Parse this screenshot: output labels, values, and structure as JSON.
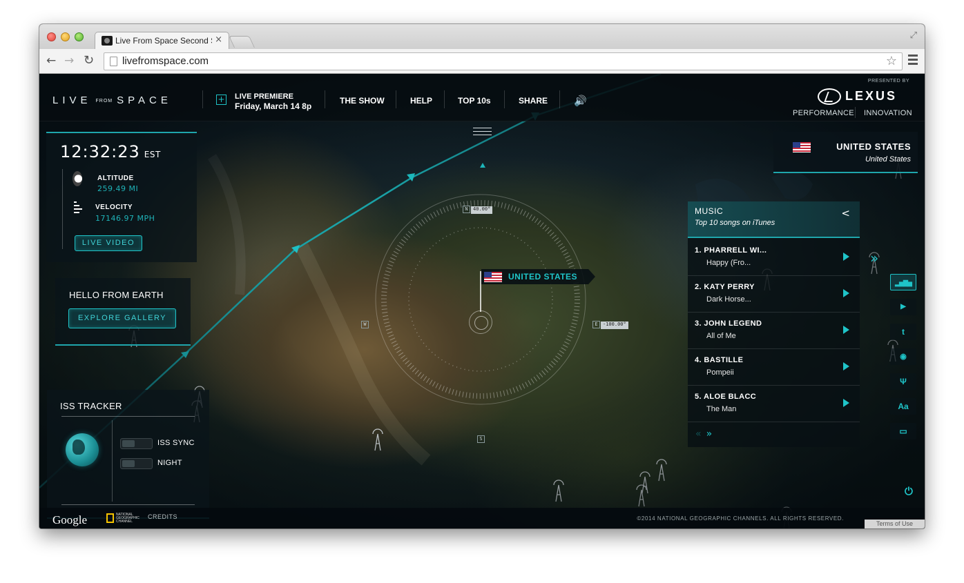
{
  "browser": {
    "tab_title": "Live From Space Second Screen",
    "tab_close": "×",
    "url": "livefromspace.com",
    "back": "←",
    "forward": "→",
    "reload": "↻",
    "star": "☆",
    "fullscreen": "⤢"
  },
  "header": {
    "logo_live": "LIVE",
    "logo_from": "FROM",
    "logo_space": "SPACE",
    "premiere_label": "LIVE PREMIERE",
    "premiere_date": "Friday, March 14 8p",
    "nav": [
      "THE SHOW",
      "HELP",
      "TOP 10s",
      "SHARE"
    ],
    "sound_icon": "🔊",
    "presented_by": "PRESENTED BY",
    "sponsor": "LEXUS",
    "sponsor_links": [
      "PERFORMANCE",
      "INNOVATION"
    ]
  },
  "status": {
    "time": "12:32:23",
    "timezone": "EST",
    "altitude_label": "ALTITUDE",
    "altitude_value": "259.49 MI",
    "velocity_label": "VELOCITY",
    "velocity_value": "17146.97 MPH",
    "live_video_label": "LIVE VIDEO"
  },
  "hello": {
    "title": "HELLO FROM EARTH",
    "button": "EXPLORE GALLERY"
  },
  "tracker": {
    "title": "ISS TRACKER",
    "toggles": [
      {
        "label": "ISS SYNC"
      },
      {
        "label": "NIGHT"
      }
    ]
  },
  "map": {
    "north_letter": "N",
    "north_value": "40.00°",
    "east_letter": "E",
    "east_value": "-100.00°",
    "west_letter": "W",
    "south_letter": "S",
    "location_label": "UNITED STATES"
  },
  "country": {
    "name": "UNITED STATES",
    "subtitle": "United States"
  },
  "music": {
    "title": "MUSIC",
    "subtitle": "Top 10 songs on iTunes",
    "share_icon": "<",
    "tracks": [
      {
        "artist": "1. PHARRELL WI...",
        "song": "Happy (Fro..."
      },
      {
        "artist": "2. KATY PERRY",
        "song": "Dark Horse..."
      },
      {
        "artist": "3. JOHN LEGEND",
        "song": "All of Me"
      },
      {
        "artist": "4. BASTILLE",
        "song": "Pompeii"
      },
      {
        "artist": "5. ALOE BLACC",
        "song": "The Man"
      }
    ],
    "prev": "«",
    "next": "»"
  },
  "sidebar": {
    "expand": "»",
    "icons": [
      {
        "name": "music-chart-icon",
        "glyph": "▂▅▇▅"
      },
      {
        "name": "play-icon",
        "glyph": "▶"
      },
      {
        "name": "twitter-icon",
        "glyph": "t"
      },
      {
        "name": "location-pin-icon",
        "glyph": "◉"
      },
      {
        "name": "food-icon",
        "glyph": "Ψ"
      },
      {
        "name": "font-icon",
        "glyph": "Aa"
      },
      {
        "name": "screen-icon",
        "glyph": "▭"
      }
    ],
    "power": "⏻"
  },
  "footer": {
    "google": "Google",
    "natgeo": "NATIONAL GEOGRAPHIC CHANNEL",
    "credits": "CREDITS",
    "copyright": "©2014 NATIONAL GEOGRAPHIC CHANNELS. ALL RIGHTS RESERVED.",
    "terms": "Terms of Use"
  },
  "colors": {
    "accent": "#1fc4c8",
    "accent_line": "#1fa6ac",
    "panel_bg": "#0a141a"
  }
}
